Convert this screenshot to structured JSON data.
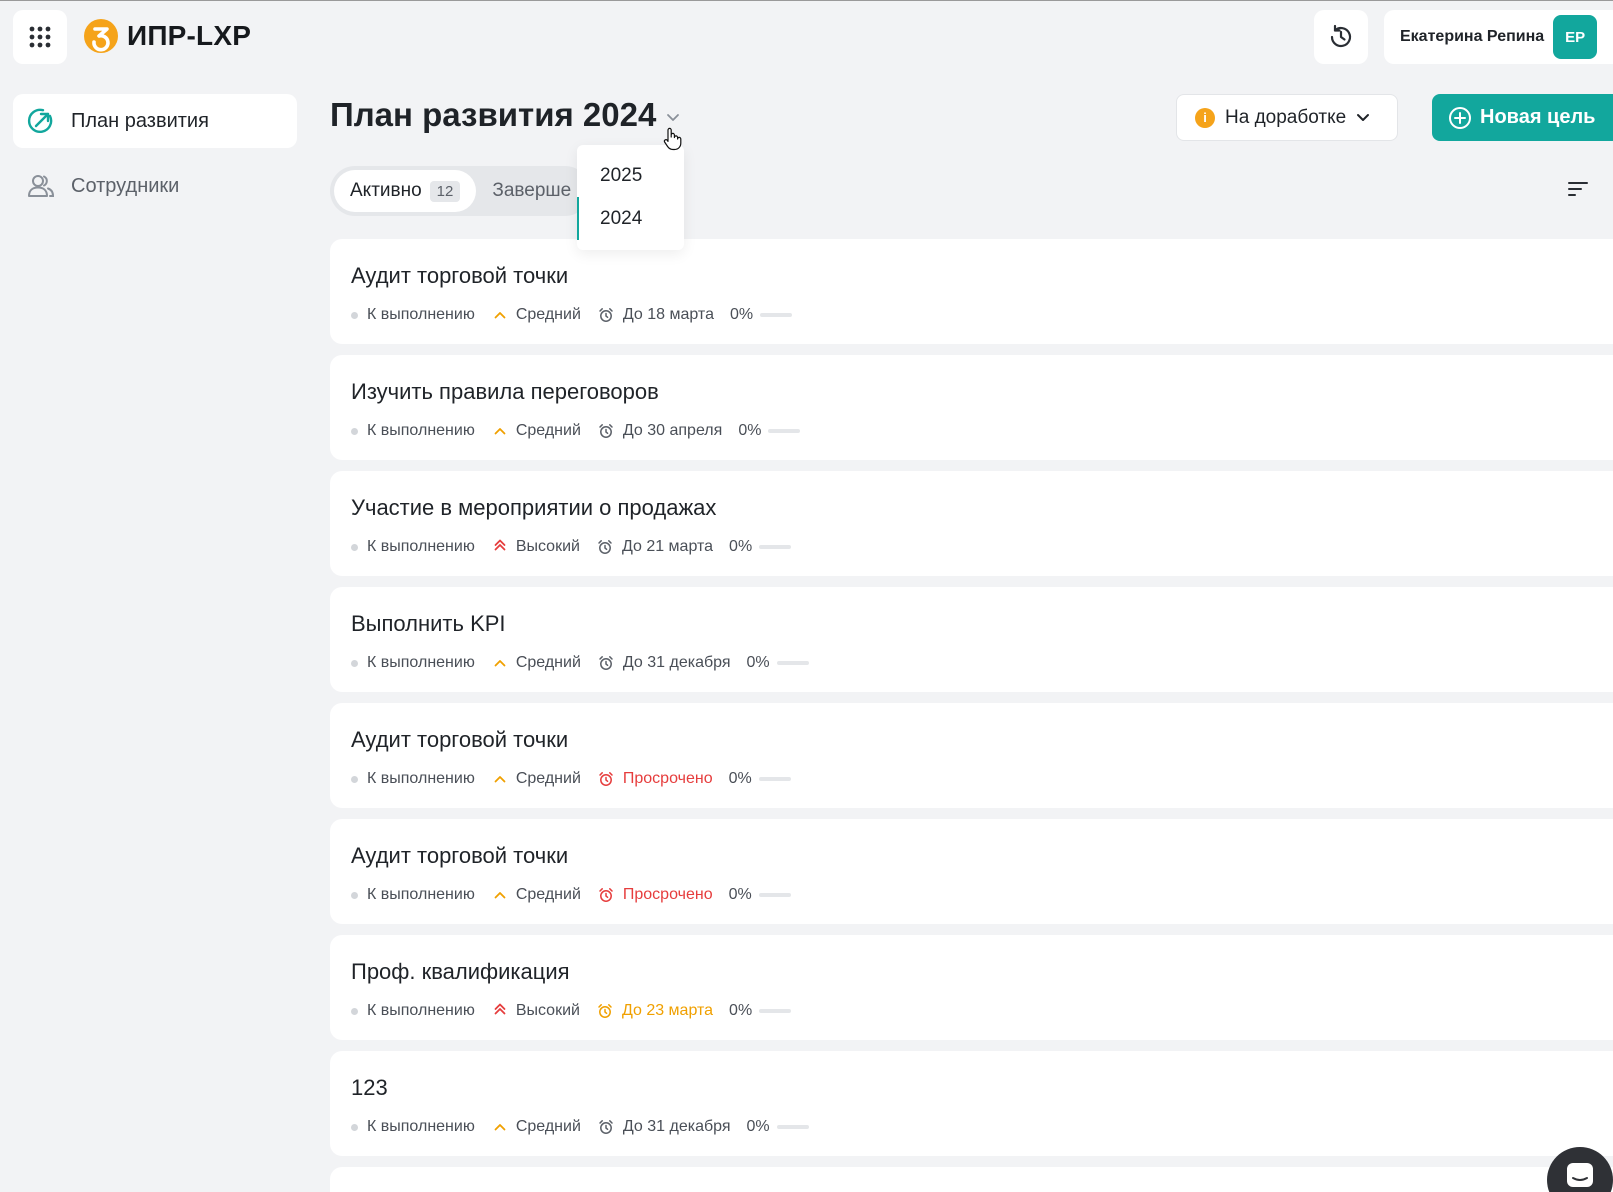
{
  "app": {
    "logo_text": "ИПР-LXP"
  },
  "user": {
    "name": "Екатерина Репина",
    "initials": "ЕР"
  },
  "sidebar": {
    "items": [
      {
        "label": "План развития",
        "icon": "growth-arrow-icon",
        "active": true
      },
      {
        "label": "Сотрудники",
        "icon": "users-icon",
        "active": false
      }
    ]
  },
  "plan": {
    "title": "План развития 2024"
  },
  "status_filter": {
    "label": "На доработке",
    "color": "#f5a31a"
  },
  "new_goal": {
    "label": "Новая цель"
  },
  "tabs": [
    {
      "label": "Активно",
      "count": "12",
      "active": true
    },
    {
      "label": "Заверше",
      "active": false
    }
  ],
  "year_dropdown": {
    "options": [
      "2025",
      "2024"
    ],
    "selected": "2024"
  },
  "goals": [
    {
      "title": "Аудит торговой точки",
      "status": "К выполнению",
      "priority": "Средний",
      "priority_level": "medium",
      "deadline": "До 18 марта",
      "deadline_state": "normal",
      "progress": 0,
      "progress_label": "0%"
    },
    {
      "title": "Изучить правила переговоров",
      "status": "К выполнению",
      "priority": "Средний",
      "priority_level": "medium",
      "deadline": "До 30 апреля",
      "deadline_state": "normal",
      "progress": 0,
      "progress_label": "0%"
    },
    {
      "title": "Участие в мероприятии о продажах",
      "status": "К выполнению",
      "priority": "Высокий",
      "priority_level": "high",
      "deadline": "До 21 марта",
      "deadline_state": "normal",
      "progress": 0,
      "progress_label": "0%"
    },
    {
      "title": "Выполнить KPI",
      "status": "К выполнению",
      "priority": "Средний",
      "priority_level": "medium",
      "deadline": "До 31 декабря",
      "deadline_state": "normal",
      "progress": 0,
      "progress_label": "0%"
    },
    {
      "title": "Аудит торговой точки",
      "status": "К выполнению",
      "priority": "Средний",
      "priority_level": "medium",
      "deadline": "Просрочено",
      "deadline_state": "overdue",
      "progress": 0,
      "progress_label": "0%"
    },
    {
      "title": "Аудит торговой точки",
      "status": "К выполнению",
      "priority": "Средний",
      "priority_level": "medium",
      "deadline": "Просрочено",
      "deadline_state": "overdue",
      "progress": 0,
      "progress_label": "0%"
    },
    {
      "title": "Проф. квалификация",
      "status": "К выполнению",
      "priority": "Высокий",
      "priority_level": "high",
      "deadline": "До 23 марта",
      "deadline_state": "soon",
      "progress": 0,
      "progress_label": "0%"
    },
    {
      "title": "123",
      "status": "К выполнению",
      "priority": "Средний",
      "priority_level": "medium",
      "deadline": "До 31 декабря",
      "deadline_state": "normal",
      "progress": 0,
      "progress_label": "0%"
    }
  ],
  "colors": {
    "accent": "#12a79d",
    "priority_medium": "#f0a000",
    "priority_high": "#e63d3d",
    "overdue": "#e63d3d",
    "soon": "#f0a000",
    "deadline_normal": "#5c6169"
  }
}
